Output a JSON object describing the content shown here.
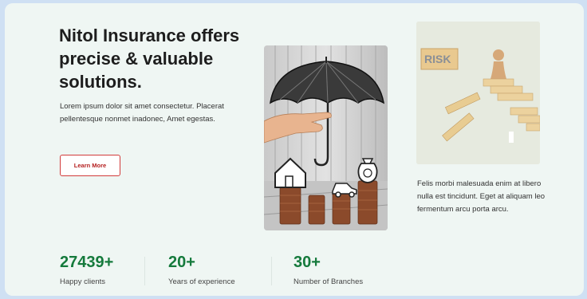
{
  "hero": {
    "title": "Nitol Insurance offers precise & valuable solutions.",
    "description": "Lorem ipsum dolor sit amet consectetur. Placerat pellentesque nonmet inadonec, Amet egestas.",
    "button_label": "Learn More"
  },
  "images": {
    "umbrella_photo": "umbrella-coins-icon",
    "risk_photo": {
      "icon": "risk-blocks-icon",
      "caption": "RISK"
    }
  },
  "side_text": "Felis morbi malesuada enim at libero nulla est tincidunt. Eget at aliquam leo fermentum arcu porta arcu.",
  "stats": [
    {
      "value": "27439+",
      "label": "Happy clients"
    },
    {
      "value": "20+",
      "label": "Years of experience"
    },
    {
      "value": "30+",
      "label": "Number of Branches"
    }
  ],
  "colors": {
    "accent_green": "#157a3c",
    "button_red": "#d23b3b",
    "card_bg": "#eff6f3",
    "page_bg": "#cfe0f3"
  }
}
